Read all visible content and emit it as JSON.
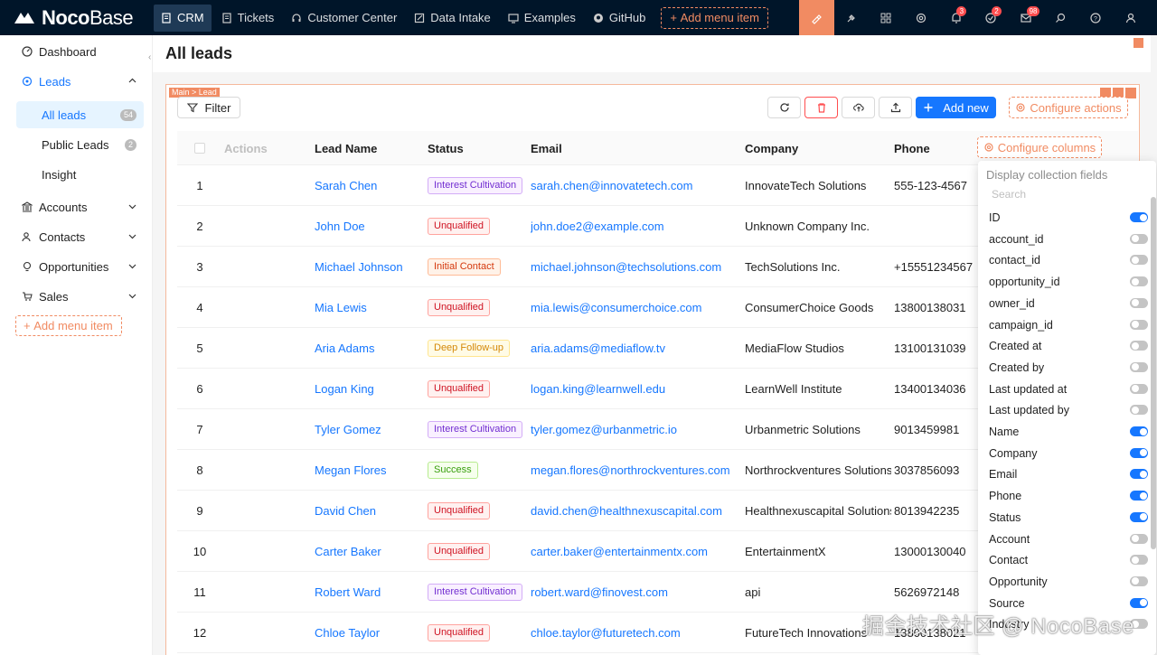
{
  "brand": {
    "name_bold": "Noco",
    "name_rest": "Base"
  },
  "topnav": {
    "items": [
      {
        "label": "CRM",
        "icon": "file-icon"
      },
      {
        "label": "Tickets",
        "icon": "file-icon"
      },
      {
        "label": "Customer Center",
        "icon": "headset-icon"
      },
      {
        "label": "Data Intake",
        "icon": "form-icon"
      },
      {
        "label": "Examples",
        "icon": "desktop-icon"
      },
      {
        "label": "GitHub",
        "icon": "github-icon"
      }
    ],
    "add_menu_label": "Add menu item",
    "badges": {
      "bell": "3",
      "help": "2",
      "mail": "98"
    }
  },
  "sidebar": {
    "items": [
      {
        "label": "Dashboard"
      },
      {
        "label": "Leads"
      },
      {
        "label": "All leads",
        "count": "54"
      },
      {
        "label": "Public Leads",
        "count": "2"
      },
      {
        "label": "Insight"
      },
      {
        "label": "Accounts"
      },
      {
        "label": "Contacts"
      },
      {
        "label": "Opportunities"
      },
      {
        "label": "Sales"
      }
    ],
    "add_menu_label": "Add menu item"
  },
  "page": {
    "title": "All leads",
    "breadcrumb": "Main > Lead"
  },
  "toolbar": {
    "filter": "Filter",
    "add_new": "Add new",
    "configure_actions": "Configure actions"
  },
  "table": {
    "headers": {
      "actions": "Actions",
      "name": "Lead Name",
      "status": "Status",
      "email": "Email",
      "company": "Company",
      "phone": "Phone"
    },
    "configure_columns": "Configure columns",
    "rows": [
      {
        "idx": "1",
        "name": "Sarah Chen",
        "status": "Interest Cultivation",
        "email": "sarah.chen@innovatetech.com",
        "company": "InnovateTech Solutions",
        "phone": "555-123-4567"
      },
      {
        "idx": "2",
        "name": "John Doe",
        "status": "Unqualified",
        "email": "john.doe2@example.com",
        "company": "Unknown Company Inc.",
        "phone": ""
      },
      {
        "idx": "3",
        "name": "Michael Johnson",
        "status": "Initial Contact",
        "email": "michael.johnson@techsolutions.com",
        "company": "TechSolutions Inc.",
        "phone": "+15551234567"
      },
      {
        "idx": "4",
        "name": "Mia Lewis",
        "status": "Unqualified",
        "email": "mia.lewis@consumerchoice.com",
        "company": "ConsumerChoice Goods",
        "phone": "13800138031"
      },
      {
        "idx": "5",
        "name": "Aria Adams",
        "status": "Deep Follow-up",
        "email": "aria.adams@mediaflow.tv",
        "company": "MediaFlow Studios",
        "phone": "13100131039"
      },
      {
        "idx": "6",
        "name": "Logan King",
        "status": "Unqualified",
        "email": "logan.king@learnwell.edu",
        "company": "LearnWell Institute",
        "phone": "13400134036"
      },
      {
        "idx": "7",
        "name": "Tyler Gomez",
        "status": "Interest Cultivation",
        "email": "tyler.gomez@urbanmetric.io",
        "company": "Urbanmetric Solutions",
        "phone": "9013459981"
      },
      {
        "idx": "8",
        "name": "Megan Flores",
        "status": "Success",
        "email": "megan.flores@northrockventures.com",
        "company": "Northrockventures Solutions",
        "phone": "3037856093"
      },
      {
        "idx": "9",
        "name": "David Chen",
        "status": "Unqualified",
        "email": "david.chen@healthnexuscapital.com",
        "company": "Healthnexuscapital Solutions",
        "phone": "8013942235"
      },
      {
        "idx": "10",
        "name": "Carter Baker",
        "status": "Unqualified",
        "email": "carter.baker@entertainmentx.com",
        "company": "EntertainmentX",
        "phone": "13000130040"
      },
      {
        "idx": "11",
        "name": "Robert Ward",
        "status": "Interest Cultivation",
        "email": "robert.ward@finovest.com",
        "company": "api",
        "phone": "5626972148"
      },
      {
        "idx": "12",
        "name": "Chloe Taylor",
        "status": "Unqualified",
        "email": "chloe.taylor@futuretech.com",
        "company": "FutureTech Innovations",
        "phone": "13800138021"
      }
    ]
  },
  "popover": {
    "title": "Display collection fields",
    "search_placeholder": "Search",
    "fields": [
      {
        "label": "ID",
        "on": true
      },
      {
        "label": "account_id",
        "on": false
      },
      {
        "label": "contact_id",
        "on": false
      },
      {
        "label": "opportunity_id",
        "on": false
      },
      {
        "label": "owner_id",
        "on": false
      },
      {
        "label": "campaign_id",
        "on": false
      },
      {
        "label": "Created at",
        "on": false
      },
      {
        "label": "Created by",
        "on": false
      },
      {
        "label": "Last updated at",
        "on": false
      },
      {
        "label": "Last updated by",
        "on": false
      },
      {
        "label": "Name",
        "on": true
      },
      {
        "label": "Company",
        "on": true
      },
      {
        "label": "Email",
        "on": true
      },
      {
        "label": "Phone",
        "on": true
      },
      {
        "label": "Status",
        "on": true
      },
      {
        "label": "Account",
        "on": false
      },
      {
        "label": "Contact",
        "on": false
      },
      {
        "label": "Opportunity",
        "on": false
      },
      {
        "label": "Source",
        "on": true
      },
      {
        "label": "Industry",
        "on": false
      }
    ]
  },
  "watermark": "掘金技术社区 @ NocoBase",
  "colors": {
    "accent": "#1677ff",
    "brand_orange": "#f18b62",
    "topbar": "#001529"
  }
}
